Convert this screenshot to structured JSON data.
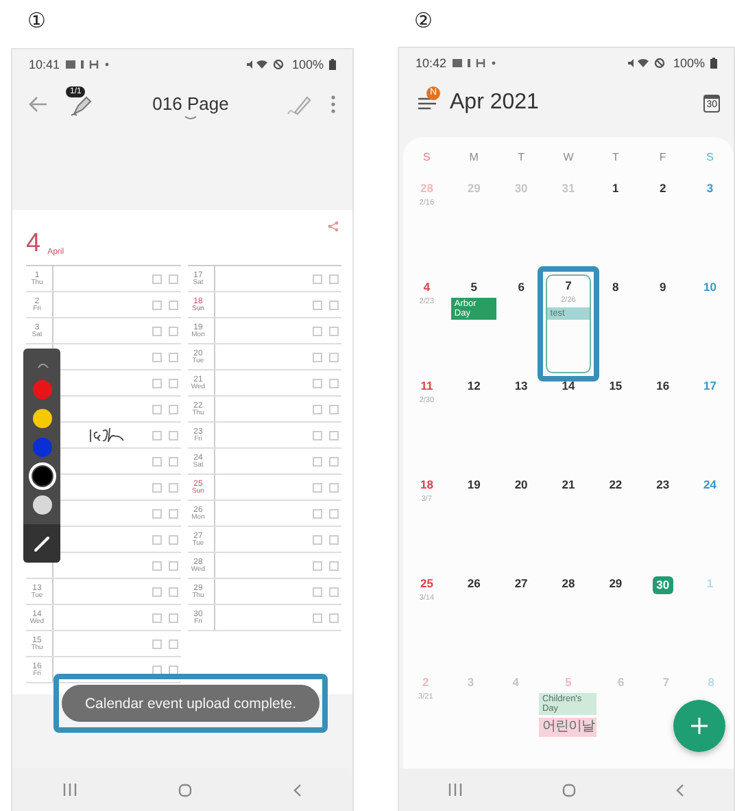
{
  "note_app": {
    "marker": "①",
    "status_bar": {
      "time": "10:41",
      "battery": "100%"
    },
    "toolbar": {
      "badge": "1/1",
      "title": "016 Page"
    },
    "planner": {
      "month": "4",
      "month_name": "April",
      "left_rows": [
        {
          "day": "1",
          "weekday": "Thu",
          "color": "#8a8a8a"
        },
        {
          "day": "2",
          "weekday": "Fri",
          "color": "#8a8a8a"
        },
        {
          "day": "3",
          "weekday": "Sat",
          "color": "#8a8a8a"
        },
        {},
        {},
        {},
        {},
        {},
        {},
        {},
        {},
        {},
        {
          "day": "13",
          "weekday": "Tue",
          "color": "#8a8a8a"
        },
        {
          "day": "14",
          "weekday": "Wed",
          "color": "#8a8a8a"
        },
        {
          "day": "15",
          "weekday": "Thu",
          "color": "#8a8a8a"
        },
        {
          "day": "16",
          "weekday": "Fri",
          "color": "#8a8a8a"
        }
      ],
      "right_rows": [
        {
          "day": "17",
          "weekday": "Sat",
          "color": "#8a8a8a"
        },
        {
          "day": "18",
          "weekday": "Sun",
          "color": "#c8506a"
        },
        {
          "day": "19",
          "weekday": "Mon",
          "color": "#8a8a8a"
        },
        {
          "day": "20",
          "weekday": "Tue",
          "color": "#8a8a8a"
        },
        {
          "day": "21",
          "weekday": "Wed",
          "color": "#8a8a8a"
        },
        {
          "day": "22",
          "weekday": "Thu",
          "color": "#8a8a8a"
        },
        {
          "day": "23",
          "weekday": "Fri",
          "color": "#8a8a8a"
        },
        {
          "day": "24",
          "weekday": "Sat",
          "color": "#8a8a8a"
        },
        {
          "day": "25",
          "weekday": "Sun",
          "color": "#c8506a"
        },
        {
          "day": "26",
          "weekday": "Mon",
          "color": "#8a8a8a"
        },
        {
          "day": "27",
          "weekday": "Tue",
          "color": "#8a8a8a"
        },
        {
          "day": "28",
          "weekday": "Wed",
          "color": "#8a8a8a"
        },
        {
          "day": "29",
          "weekday": "Thu",
          "color": "#8a8a8a"
        },
        {
          "day": "30",
          "weekday": "Fri",
          "color": "#8a8a8a"
        }
      ]
    },
    "pen_colors": [
      {
        "color": "#e8141a",
        "selected": false
      },
      {
        "color": "#f5c800",
        "selected": false
      },
      {
        "color": "#0a2fd6",
        "selected": false
      },
      {
        "color": "#000000",
        "selected": true
      },
      {
        "color": "#d8d8d8",
        "selected": false
      }
    ],
    "toast": "Calendar event upload complete."
  },
  "calendar_app": {
    "marker": "②",
    "status_bar": {
      "time": "10:42",
      "battery": "100%"
    },
    "header": {
      "badge": "N",
      "title": "Apr 2021",
      "today_icon": "30"
    },
    "weekdays": [
      {
        "label": "S",
        "color": "#e07b85"
      },
      {
        "label": "M",
        "color": "#8a8a8a"
      },
      {
        "label": "T",
        "color": "#8a8a8a"
      },
      {
        "label": "W",
        "color": "#8a8a8a"
      },
      {
        "label": "T",
        "color": "#8a8a8a"
      },
      {
        "label": "F",
        "color": "#8a8a8a"
      },
      {
        "label": "S",
        "color": "#5aaed4"
      }
    ],
    "weeks": [
      [
        {
          "day": "28",
          "lunar": "2/16",
          "color": "#f0b9be",
          "today": false,
          "selected": false
        },
        {
          "day": "29",
          "color": "#c6c6c6",
          "today": false,
          "selected": false
        },
        {
          "day": "30",
          "color": "#c6c6c6",
          "today": false,
          "selected": false
        },
        {
          "day": "31",
          "color": "#c6c6c6",
          "today": false,
          "selected": false
        },
        {
          "day": "1",
          "color": "#333333",
          "today": false,
          "selected": false
        },
        {
          "day": "2",
          "color": "#333333",
          "today": false,
          "selected": false
        },
        {
          "day": "3",
          "color": "#3b97c4",
          "today": false,
          "selected": false
        }
      ],
      [
        {
          "day": "4",
          "lunar": "2/23",
          "color": "#d9434e",
          "today": false,
          "selected": false
        },
        {
          "day": "5",
          "color": "#333333",
          "today": false,
          "selected": false,
          "events": [
            {
              "title": "Arbor Day",
              "kind": "solid",
              "color": "#2a9d63"
            }
          ]
        },
        {
          "day": "6",
          "color": "#333333",
          "today": false,
          "selected": false
        },
        {
          "day": "7",
          "lunar": "2/26",
          "color": "#333333",
          "today": false,
          "selected": true,
          "events": [
            {
              "title": "test",
              "kind": "tint",
              "color": "#a3d6d2"
            }
          ]
        },
        {
          "day": "8",
          "color": "#333333",
          "today": false,
          "selected": false
        },
        {
          "day": "9",
          "color": "#333333",
          "today": false,
          "selected": false
        },
        {
          "day": "10",
          "color": "#3b97c4",
          "today": false,
          "selected": false
        }
      ],
      [
        {
          "day": "11",
          "lunar": "2/30",
          "color": "#d9434e",
          "today": false,
          "selected": false
        },
        {
          "day": "12",
          "color": "#333333",
          "today": false,
          "selected": false
        },
        {
          "day": "13",
          "color": "#333333",
          "today": false,
          "selected": false
        },
        {
          "day": "14",
          "color": "#333333",
          "today": false,
          "selected": false
        },
        {
          "day": "15",
          "color": "#333333",
          "today": false,
          "selected": false
        },
        {
          "day": "16",
          "color": "#333333",
          "today": false,
          "selected": false
        },
        {
          "day": "17",
          "color": "#3b97c4",
          "today": false,
          "selected": false
        }
      ],
      [
        {
          "day": "18",
          "lunar": "3/7",
          "color": "#d9434e",
          "today": false,
          "selected": false
        },
        {
          "day": "19",
          "color": "#333333",
          "today": false,
          "selected": false
        },
        {
          "day": "20",
          "color": "#333333",
          "today": false,
          "selected": false
        },
        {
          "day": "21",
          "color": "#333333",
          "today": false,
          "selected": false
        },
        {
          "day": "22",
          "color": "#333333",
          "today": false,
          "selected": false
        },
        {
          "day": "23",
          "color": "#333333",
          "today": false,
          "selected": false
        },
        {
          "day": "24",
          "color": "#3b97c4",
          "today": false,
          "selected": false
        }
      ],
      [
        {
          "day": "25",
          "lunar": "3/14",
          "color": "#d9434e",
          "today": false,
          "selected": false
        },
        {
          "day": "26",
          "color": "#333333",
          "today": false,
          "selected": false
        },
        {
          "day": "27",
          "color": "#333333",
          "today": false,
          "selected": false
        },
        {
          "day": "28",
          "color": "#333333",
          "today": false,
          "selected": false
        },
        {
          "day": "29",
          "color": "#333333",
          "today": false,
          "selected": false
        },
        {
          "day": "30",
          "color": "#1f9e74",
          "today": true,
          "selected": false
        },
        {
          "day": "1",
          "color": "#b7dbec",
          "today": false,
          "selected": false
        }
      ],
      [
        {
          "day": "2",
          "lunar": "3/21",
          "color": "#f0b9be",
          "today": false,
          "selected": false
        },
        {
          "day": "3",
          "color": "#c6c6c6",
          "today": false,
          "selected": false
        },
        {
          "day": "4",
          "color": "#c6c6c6",
          "today": false,
          "selected": false
        },
        {
          "day": "5",
          "color": "#f0b9be",
          "today": false,
          "selected": false,
          "events": [
            {
              "title": "Children's Day",
              "kind": "tint",
              "color": "#cfeadb"
            },
            {
              "title": "어린이날",
              "kind": "tint",
              "color": "#f7d2da"
            }
          ]
        },
        {
          "day": "6",
          "color": "#c6c6c6",
          "today": false,
          "selected": false
        },
        {
          "day": "7",
          "color": "#c6c6c6",
          "today": false,
          "selected": false
        },
        {
          "day": "8",
          "color": "#b7dbec",
          "today": false,
          "selected": false
        }
      ]
    ]
  }
}
